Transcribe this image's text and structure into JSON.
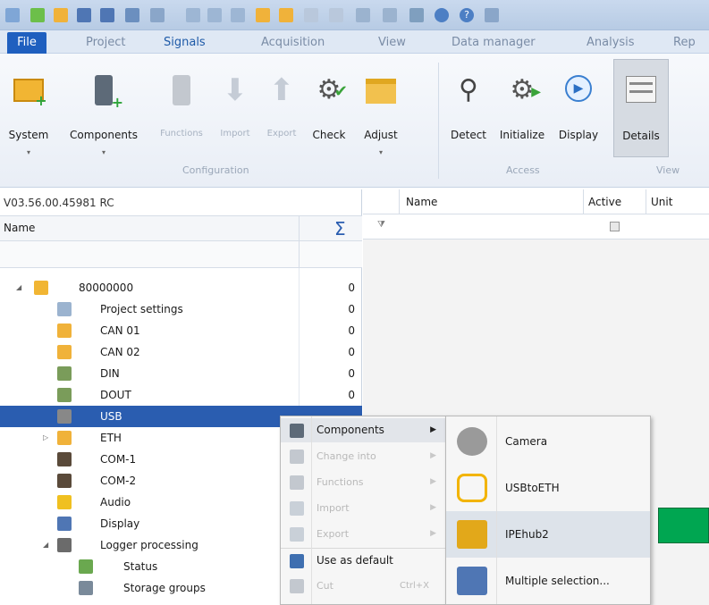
{
  "tabs": {
    "file": "File",
    "items": [
      "Project",
      "Signals",
      "Acquisition",
      "View",
      "Data manager",
      "Analysis",
      "Rep"
    ],
    "active": "Signals"
  },
  "ribbon": {
    "buttons": [
      {
        "label": "System",
        "icon": "system-icon",
        "disabled": false,
        "dropdown": true
      },
      {
        "label": "Components",
        "icon": "components-icon",
        "disabled": false,
        "dropdown": true
      },
      {
        "label": "Functions",
        "icon": "functions-icon",
        "disabled": true,
        "dropdown": false
      },
      {
        "label": "Import",
        "icon": "import-icon",
        "disabled": true,
        "dropdown": false
      },
      {
        "label": "Export",
        "icon": "export-icon",
        "disabled": true,
        "dropdown": false
      },
      {
        "label": "Check",
        "icon": "check-gear-icon",
        "disabled": false,
        "dropdown": false
      },
      {
        "label": "Adjust",
        "icon": "folder-adjust-icon",
        "disabled": false,
        "dropdown": true
      },
      {
        "label": "Detect",
        "icon": "binoculars-icon",
        "disabled": false,
        "dropdown": false
      },
      {
        "label": "Initialize",
        "icon": "initialize-gear-icon",
        "disabled": false,
        "dropdown": false
      },
      {
        "label": "Display",
        "icon": "play-icon",
        "disabled": false,
        "dropdown": false
      },
      {
        "label": "Details",
        "icon": "details-icon",
        "disabled": false,
        "dropdown": false
      }
    ],
    "groups": {
      "configuration": "Configuration",
      "access": "Access",
      "view": "View"
    }
  },
  "left": {
    "version": "V03.56.00.45981 RC",
    "col_name": "Name",
    "col_sum": "Σ",
    "tree": [
      {
        "label": "80000000",
        "count": "0",
        "level": 0,
        "expander": "◢"
      },
      {
        "label": "Project settings",
        "count": "0",
        "level": 1
      },
      {
        "label": "CAN 01",
        "count": "0",
        "level": 1
      },
      {
        "label": "CAN 02",
        "count": "0",
        "level": 1
      },
      {
        "label": "DIN",
        "count": "0",
        "level": 1
      },
      {
        "label": "DOUT",
        "count": "0",
        "level": 1
      },
      {
        "label": "USB",
        "count": "",
        "level": 1,
        "selected": true
      },
      {
        "label": "ETH",
        "count": "",
        "level": 1,
        "expander": "▷"
      },
      {
        "label": "COM-1",
        "count": "",
        "level": 1
      },
      {
        "label": "COM-2",
        "count": "",
        "level": 1
      },
      {
        "label": "Audio",
        "count": "",
        "level": 1
      },
      {
        "label": "Display",
        "count": "",
        "level": 1
      },
      {
        "label": "Logger processing",
        "count": "",
        "level": 1,
        "expander": "◢"
      },
      {
        "label": "Status",
        "count": "",
        "level": 2
      },
      {
        "label": "Storage groups",
        "count": "",
        "level": 2
      }
    ]
  },
  "right": {
    "col_name": "Name",
    "col_active": "Active",
    "col_unit": "Unit"
  },
  "context_menu": [
    {
      "label": "Components",
      "disabled": false,
      "submenu": true,
      "shortcut": ""
    },
    {
      "label": "Change into",
      "disabled": true,
      "submenu": true,
      "shortcut": ""
    },
    {
      "label": "Functions",
      "disabled": true,
      "submenu": true,
      "shortcut": ""
    },
    {
      "label": "Import",
      "disabled": true,
      "submenu": true,
      "shortcut": ""
    },
    {
      "label": "Export",
      "disabled": true,
      "submenu": true,
      "shortcut": ""
    },
    {
      "label": "Use as default",
      "disabled": false,
      "submenu": false,
      "shortcut": ""
    },
    {
      "label": "Cut",
      "disabled": true,
      "submenu": false,
      "shortcut": "Ctrl+X"
    }
  ],
  "submenu": [
    {
      "label": "Camera",
      "icon": "camera-icon",
      "highlighted": false
    },
    {
      "label": "USBtoETH",
      "icon": "usb-to-eth-icon",
      "highlighted": false
    },
    {
      "label": "IPEhub2",
      "icon": "ipehub-icon",
      "highlighted": true
    },
    {
      "label": "Multiple selection...",
      "icon": "multiple-selection-icon",
      "highlighted": false
    }
  ],
  "colors": {
    "selection": "#2a5db0",
    "accent": "#1f5fbf",
    "green_marker": "#00a651"
  }
}
